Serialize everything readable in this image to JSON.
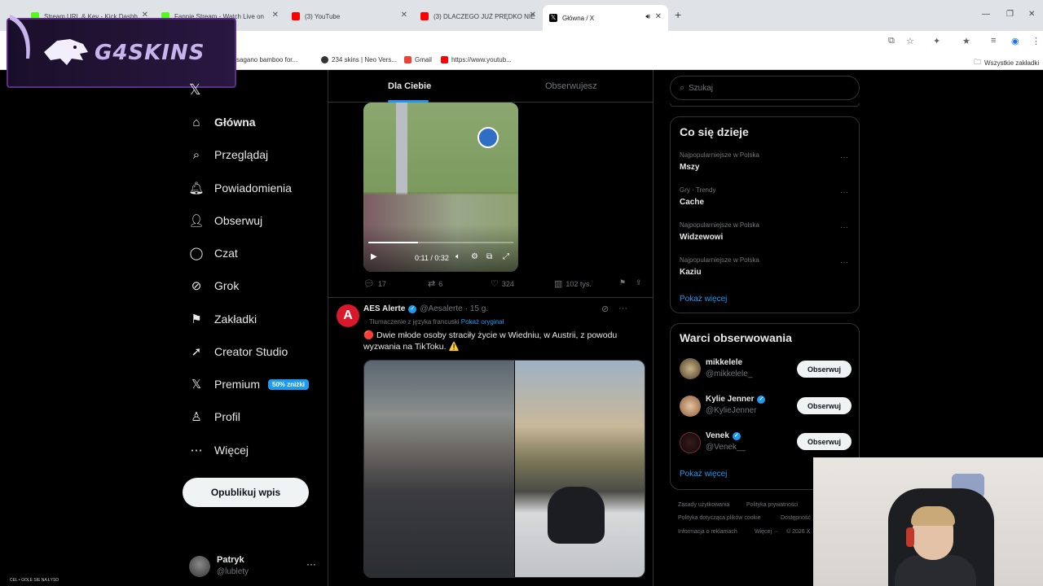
{
  "browser": {
    "tabs": [
      {
        "label": "Stream URL & Key - Kick Dashb",
        "color": "#53fc18"
      },
      {
        "label": "Fannie Stream - Watch Live on",
        "color": "#53fc18"
      },
      {
        "label": "(3) YouTube",
        "color": "#ff0000"
      },
      {
        "label": "(3) DLACZEGO JUŻ PRĘDKO NIE",
        "color": "#ff0000"
      },
      {
        "label": "Główna / X",
        "color": "#000000"
      }
    ],
    "new_tab": "+",
    "bookmarks": [
      {
        "label": "sagano bamboo for...",
        "color": "#3b7bd6"
      },
      {
        "label": "234 skins | Neo Vers...",
        "color": "#333333"
      },
      {
        "label": "Gmail",
        "color": "#ea4335"
      },
      {
        "label": "https://www.youtub...",
        "color": "#ff0000"
      }
    ],
    "all_bookmarks": "Wszystkie zakładki"
  },
  "overlay": {
    "brand": "G4SKINS"
  },
  "nav": {
    "items": [
      {
        "label": "Główna",
        "icon": "home-icon",
        "glyph": "⌂"
      },
      {
        "label": "Przeglądaj",
        "icon": "search-icon",
        "glyph": "⌕"
      },
      {
        "label": "Powiadomienia",
        "icon": "bell-icon",
        "glyph": "🔔︎"
      },
      {
        "label": "Obserwuj",
        "icon": "follow-icon",
        "glyph": "👤︎"
      },
      {
        "label": "Czat",
        "icon": "chat-icon",
        "glyph": "◯"
      },
      {
        "label": "Grok",
        "icon": "grok-icon",
        "glyph": "⊘"
      },
      {
        "label": "Zakładki",
        "icon": "bookmark-icon",
        "glyph": "⚑"
      },
      {
        "label": "Creator Studio",
        "icon": "rocket-icon",
        "glyph": "➚"
      },
      {
        "label": "Premium",
        "icon": "x-premium-icon",
        "glyph": "𝕏"
      },
      {
        "label": "Profil",
        "icon": "profile-icon",
        "glyph": "♙"
      },
      {
        "label": "Więcej",
        "icon": "more-icon",
        "glyph": "⋯"
      }
    ],
    "premium_badge": "50% zniżki",
    "post_button": "Opublikuj wpis",
    "profile": {
      "name": "Patryk",
      "handle": "@lublety"
    }
  },
  "feed": {
    "tabs": {
      "for_you": "Dla Ciebie",
      "following": "Obserwujesz"
    },
    "video": {
      "time": "0:11 / 0:32",
      "progress": 0.34
    },
    "tweet1_actions": {
      "replies": "17",
      "reposts": "6",
      "likes": "324",
      "views": "102 tys."
    },
    "tweet2": {
      "name": "AES Alerte",
      "handle": "@Aesalerte",
      "time": "· 15 g.",
      "translated": "Tłumaczenie z języka francuski",
      "show_original": "Pokaż oryginał",
      "text": "🔴 Dwie młode osoby straciły życie w Wiedniu, w Austrii, z powodu wyzwania na TikToku. ⚠️"
    }
  },
  "sidebar": {
    "search_placeholder": "Szukaj",
    "trends_title": "Co się dzieje",
    "trends": [
      {
        "meta": "Najpopularniejsze w Polska",
        "name": "Mszy"
      },
      {
        "meta": "Gry · Trendy",
        "name": "Cache"
      },
      {
        "meta": "Najpopularniejsze w Polska",
        "name": "Widzewowi"
      },
      {
        "meta": "Najpopularniejsze w Polska",
        "name": "Kaziu"
      }
    ],
    "show_more": "Pokaż więcej",
    "follow_title": "Warci obserwowania",
    "follow": [
      {
        "name": "mikkelele",
        "handle": "@mikkelele_",
        "verified": false
      },
      {
        "name": "Kylie Jenner",
        "handle": "@KylieJenner",
        "verified": true
      },
      {
        "name": "Venek",
        "handle": "@Venek__",
        "verified": true
      }
    ],
    "follow_button": "Obserwuj",
    "footer": [
      "Zasady użytkowania",
      "Polityka prywatności",
      "Polityka dotycząca plików cookie",
      "Dostępność",
      "Informacja o reklamach",
      "Więcej ···",
      "© 2026 X"
    ]
  },
  "corner_note": "CEL • GOLE SIE NA ŁYSO"
}
